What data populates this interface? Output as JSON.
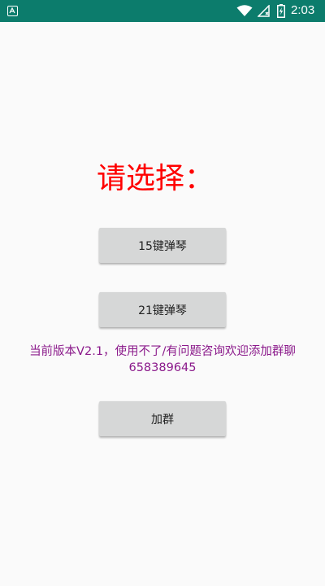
{
  "status_bar": {
    "time": "2:03",
    "background_color": "#0c7c6c",
    "icons": [
      "app-notification-icon",
      "wifi-icon",
      "no-signal-icon",
      "battery-charging-icon"
    ]
  },
  "main": {
    "title": "请选择：",
    "title_color": "#ff0000",
    "buttons": {
      "piano_15": "15键弹琴",
      "piano_21": "21键弹琴",
      "join_group": "加群"
    },
    "notice": {
      "line1": "当前版本V2.1，使用不了/有问题咨询欢迎添加群聊",
      "line2": "658389645",
      "color": "#8b1a8b"
    }
  }
}
